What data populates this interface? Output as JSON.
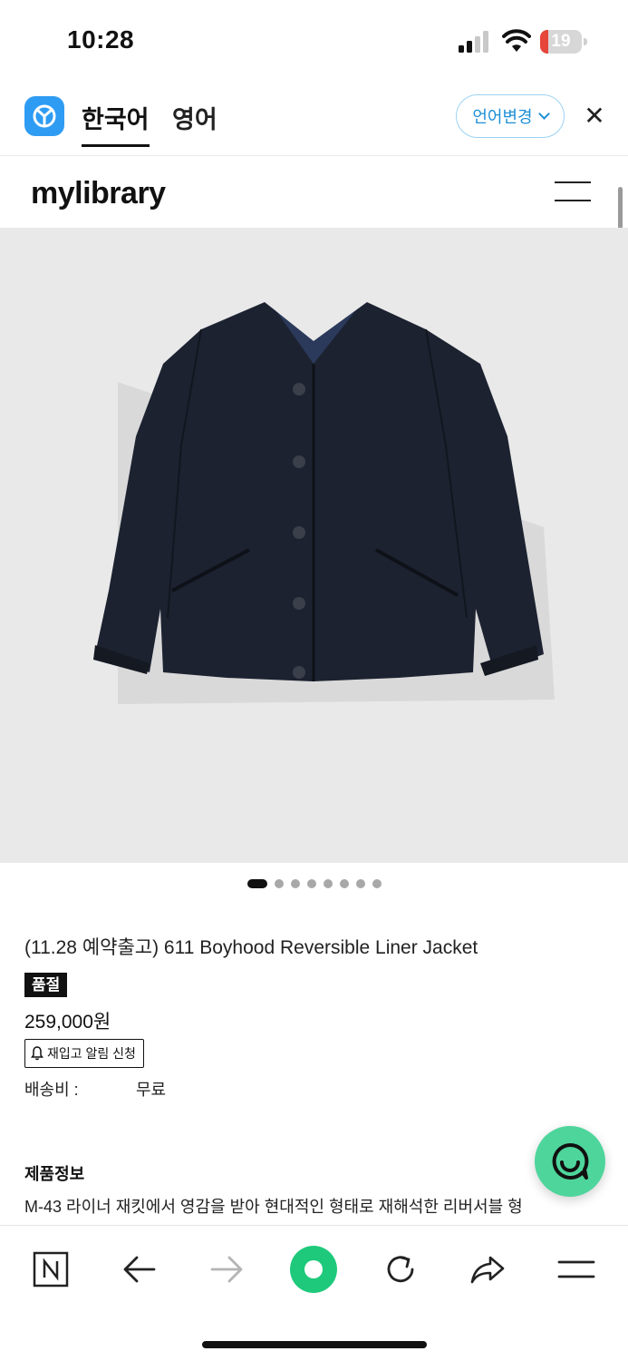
{
  "status_bar": {
    "time": "10:28",
    "battery_level": "19",
    "battery_percent": 19,
    "battery_color": "#e5453a"
  },
  "translate_bar": {
    "tabs": [
      {
        "label": "한국어",
        "active": true
      },
      {
        "label": "영어",
        "active": false
      }
    ],
    "change_language_label": "언어변경",
    "accent_color": "#1e8fd6"
  },
  "site": {
    "logo": "mylibrary"
  },
  "gallery": {
    "image_subject": "navy reversible liner jacket",
    "slide_count": 8,
    "active_slide": 1,
    "background_color": "#e9e9e9"
  },
  "product": {
    "title": "(11.28 예약출고) 611 Boyhood Reversible Liner Jacket",
    "status_badge": "품절",
    "price": "259,000원",
    "restock_button": "재입고 알림 신청",
    "shipping_label": "배송비 :",
    "shipping_value": "무료",
    "info_heading": "제품정보",
    "info_text": "M-43 라이너 재킷에서 영감을 받아 현대적인 형태로 재해석한 리버서블 형"
  },
  "chat_button": {
    "color": "#4ed59c",
    "icon": "chat-smile-icon"
  },
  "bottom_bar": {
    "items": [
      "naver-n-icon",
      "back-arrow-icon",
      "forward-arrow-icon",
      "green-dot-icon",
      "reload-icon",
      "share-icon",
      "menu-icon"
    ],
    "accent_color": "#1ec97b"
  }
}
